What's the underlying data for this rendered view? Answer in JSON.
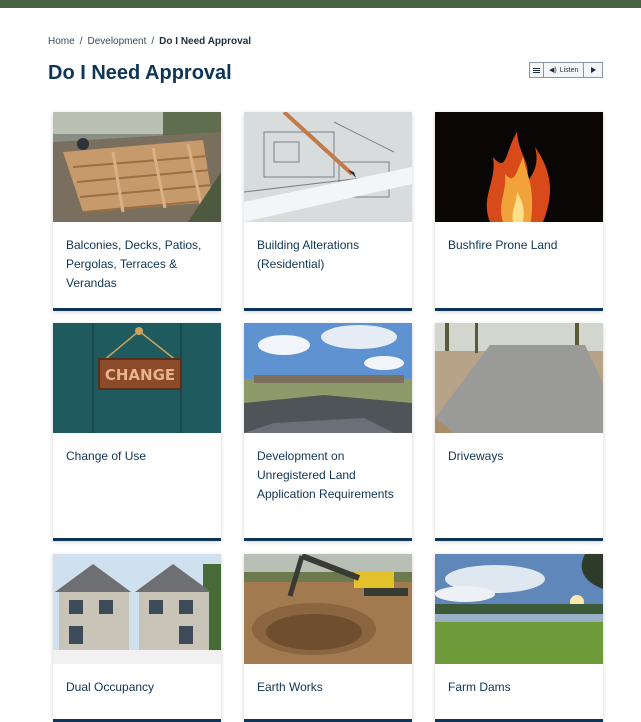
{
  "breadcrumb": {
    "items": [
      "Home",
      "Development",
      "Do I Need Approval"
    ],
    "separator": "/"
  },
  "page": {
    "title": "Do I Need Approval"
  },
  "listen": {
    "label": "Listen"
  },
  "cards": [
    {
      "title": "Balconies, Decks, Patios, Pergolas, Terraces & Verandas",
      "image": "deck-construction-photo"
    },
    {
      "title": "Building Alterations (Residential)",
      "image": "architectural-plans-photo"
    },
    {
      "title": "Bushfire Prone Land",
      "image": "fire-flames-photo"
    },
    {
      "title": "Change of Use",
      "image": "change-sign-photo",
      "image_text": "CHANGE"
    },
    {
      "title": "Development on Unregistered Land Application Requirements",
      "image": "subdivision-road-photo"
    },
    {
      "title": "Driveways",
      "image": "concrete-driveway-photo"
    },
    {
      "title": "Dual Occupancy",
      "image": "duplex-houses-photo"
    },
    {
      "title": "Earth Works",
      "image": "excavator-photo"
    },
    {
      "title": "Farm Dams",
      "image": "farm-dam-photo"
    }
  ],
  "colors": {
    "topbar": "#4a6347",
    "title": "#0e3556",
    "card_border": "#0e3556"
  }
}
